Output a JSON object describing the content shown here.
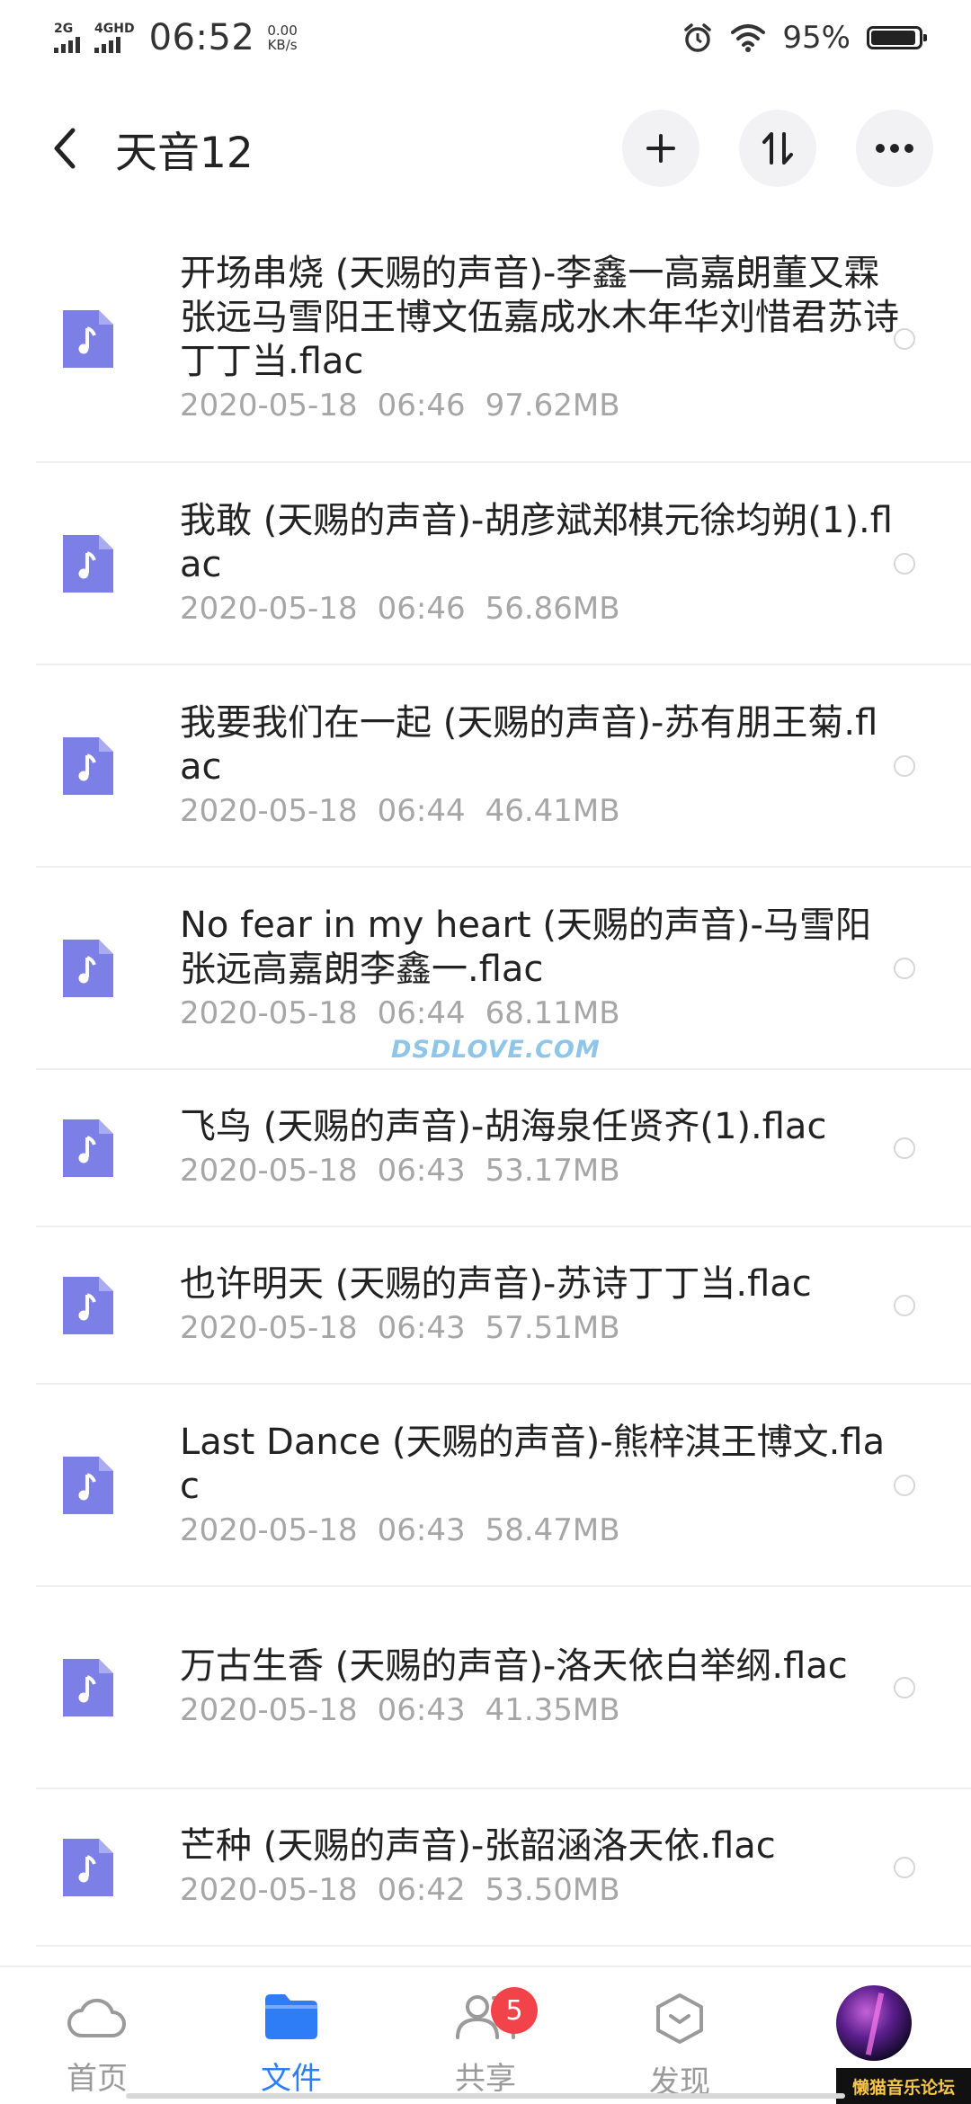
{
  "status_bar": {
    "network1": "2G",
    "network2": "4GHD",
    "time": "06:52",
    "speed_value": "0.00",
    "speed_unit": "KB/s",
    "battery_percent": "95%",
    "battery_level": 0.95,
    "icons": [
      "signal-icon",
      "alarm-icon",
      "wifi-icon",
      "battery-icon"
    ]
  },
  "header": {
    "title": "天音12",
    "buttons": [
      "back-icon",
      "add-icon",
      "sort-icon",
      "more-icon"
    ]
  },
  "files": [
    {
      "name": "开场串烧 (天赐的声音)-李鑫一高嘉朗董又霖张远马雪阳王博文伍嘉成水木年华刘惜君苏诗丁丁当.flac",
      "date": "2020-05-18",
      "time": "06:46",
      "size": "97.62MB"
    },
    {
      "name": "我敢 (天赐的声音)-胡彦斌郑棋元徐均朔(1).flac",
      "date": "2020-05-18",
      "time": "06:46",
      "size": "56.86MB"
    },
    {
      "name": "我要我们在一起 (天赐的声音)-苏有朋王菊.flac",
      "date": "2020-05-18",
      "time": "06:44",
      "size": "46.41MB"
    },
    {
      "name": "No fear in my heart (天赐的声音)-马雪阳张远高嘉朗李鑫一.flac",
      "date": "2020-05-18",
      "time": "06:44",
      "size": "68.11MB"
    },
    {
      "name": "飞鸟 (天赐的声音)-胡海泉任贤齐(1).flac",
      "date": "2020-05-18",
      "time": "06:43",
      "size": "53.17MB"
    },
    {
      "name": "也许明天 (天赐的声音)-苏诗丁丁当.flac",
      "date": "2020-05-18",
      "time": "06:43",
      "size": "57.51MB"
    },
    {
      "name": "Last Dance (天赐的声音)-熊梓淇王博文.flac",
      "date": "2020-05-18",
      "time": "06:43",
      "size": "58.47MB"
    },
    {
      "name": "万古生香 (天赐的声音)-洛天依白举纲.flac",
      "date": "2020-05-18",
      "time": "06:43",
      "size": "41.35MB"
    },
    {
      "name": "芒种 (天赐的声音)-张韶涵洛天依.flac",
      "date": "2020-05-18",
      "time": "06:42",
      "size": "53.50MB"
    }
  ],
  "watermark": "DSDLOVE.COM",
  "bottom_nav": {
    "items": [
      {
        "label": "首页",
        "icon": "cloud-icon"
      },
      {
        "label": "文件",
        "icon": "folder-icon",
        "active": true
      },
      {
        "label": "共享",
        "icon": "share-people-icon",
        "badge": "5"
      },
      {
        "label": "发现",
        "icon": "discover-icon"
      }
    ]
  },
  "forum_tag": "懒猫音乐论坛",
  "colors": {
    "accent": "#2f7df6",
    "file_icon": "#7b7fe6",
    "badge": "#f2434a",
    "meta_text": "#a6a6a6"
  }
}
